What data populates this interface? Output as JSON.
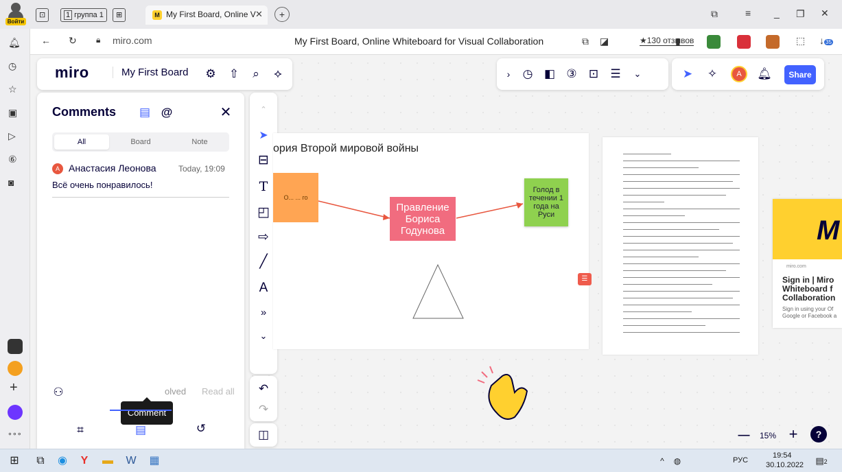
{
  "browser": {
    "login_label": "Войти",
    "tab_group_label": "группа 1",
    "tab_group_count": "1",
    "active_tab_title": "My First Board, Online V",
    "close_glyph": "✕",
    "new_tab_glyph": "+",
    "url": "miro.com",
    "page_title": "My First Board, Online Whiteboard for Visual Collaboration",
    "reviews": "★130 отзывов",
    "downloads_badge": "35"
  },
  "miro": {
    "logo": "miro",
    "board_name": "My First Board",
    "share_label": "Share",
    "avatar_letter": "A"
  },
  "comments": {
    "title": "Comments",
    "filters": [
      "All",
      "Board",
      "Note"
    ],
    "active_filter": "All",
    "items": [
      {
        "avatar": "A",
        "author": "Анастасия Леонова",
        "time": "Today, 19:09",
        "text": "Всё очень понравилось!"
      }
    ],
    "resolved_label": "olved",
    "read_all_label": "Read all",
    "tooltip": "Comment"
  },
  "board": {
    "frame_title": "ория Второй мировой войны",
    "orange_note_text": "О... ... го",
    "pink_note_text": "Правление Бориса Годунова",
    "green_note_text": "Голод в течении 1 года на Руси",
    "colors": {
      "pink": "#f16c7f",
      "green": "#8fd14f",
      "orange": "#ffa553",
      "accent": "#4262ff",
      "comment_badge": "#ef5b4c"
    }
  },
  "preview_card": {
    "source": "miro.com",
    "heading": "Sign in | Miro Whiteboard f Collaboration",
    "subtext": "Sign in using your Of Google or Facebook a"
  },
  "zoom": {
    "minus": "—",
    "value": "15%",
    "plus": "+",
    "help": "?"
  },
  "taskbar": {
    "lang": "РУС",
    "time": "19:54",
    "date": "30.10.2022",
    "notif_count": "2"
  }
}
